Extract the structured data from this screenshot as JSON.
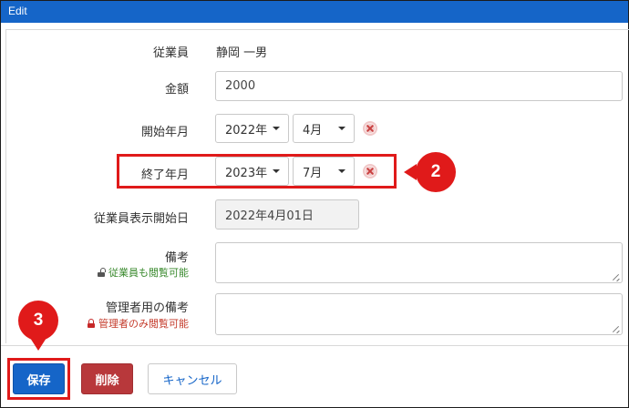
{
  "window": {
    "title": "Edit"
  },
  "form": {
    "employee": {
      "label": "従業員",
      "value": "静岡 一男"
    },
    "amount": {
      "label": "金額",
      "value": "2000"
    },
    "start": {
      "label": "開始年月",
      "year": "2022年",
      "month": "4月"
    },
    "end": {
      "label": "終了年月",
      "year": "2023年",
      "month": "7月"
    },
    "display_start": {
      "label": "従業員表示開始日",
      "value": "2022年4月01日"
    },
    "remarks": {
      "label": "備考",
      "note": "従業員も閲覧可能",
      "value": ""
    },
    "admin_remarks": {
      "label": "管理者用の備考",
      "note": "管理者のみ閲覧可能",
      "value": ""
    }
  },
  "buttons": {
    "save": "保存",
    "delete": "削除",
    "cancel": "キャンセル"
  },
  "annotations": {
    "step2": "2",
    "step3": "3",
    "highlight_color": "#e01a1a"
  },
  "colors": {
    "primary": "#1565c8",
    "danger": "#b8383b",
    "note_green": "#3a8a2e",
    "note_red": "#c43b2b"
  }
}
